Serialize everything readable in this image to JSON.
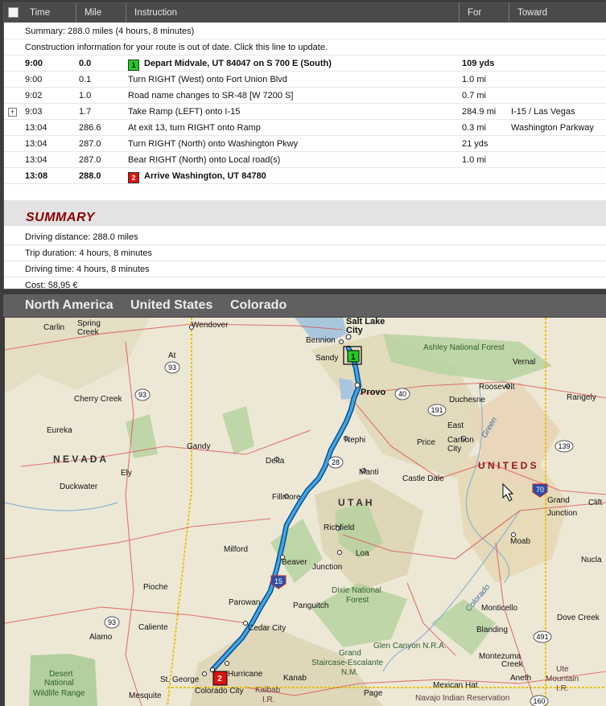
{
  "columns": {
    "time": "Time",
    "mile": "Mile",
    "instruction": "Instruction",
    "for": "For",
    "toward": "Toward"
  },
  "summary_line": "Summary:  288.0 miles (4 hours, 8 minutes)",
  "construction_line": "Construction information for your route is out of date.  Click this line to update.",
  "steps": [
    {
      "time": "9:00",
      "mile": "0.0",
      "marker": "1",
      "instruction": "Depart Midvale, UT 84047 on S 700 E (South)",
      "for": "109 yds",
      "toward": "",
      "bold": true
    },
    {
      "time": "9:00",
      "mile": "0.1",
      "marker": "",
      "instruction": "Turn RIGHT (West) onto Fort Union Blvd",
      "for": "1.0 mi",
      "toward": "",
      "bold": false
    },
    {
      "time": "9:02",
      "mile": "1.0",
      "marker": "",
      "instruction": "Road name changes to SR-48 [W 7200 S]",
      "for": "0.7 mi",
      "toward": "",
      "bold": false
    },
    {
      "time": "9:03",
      "mile": "1.7",
      "marker": "",
      "instruction": "Take Ramp (LEFT) onto I-15",
      "for": "284.9 mi",
      "toward": "I-15 / Las Vegas",
      "bold": false,
      "expandable": "+"
    },
    {
      "time": "13:04",
      "mile": "286.6",
      "marker": "",
      "instruction": "At exit 13, turn RIGHT onto Ramp",
      "for": "0.3 mi",
      "toward": "Washington Parkway",
      "bold": false
    },
    {
      "time": "13:04",
      "mile": "287.0",
      "marker": "",
      "instruction": "Turn RIGHT (North) onto Washington Pkwy",
      "for": "21 yds",
      "toward": "",
      "bold": false
    },
    {
      "time": "13:04",
      "mile": "287.0",
      "marker": "",
      "instruction": "Bear RIGHT (North) onto Local road(s)",
      "for": "1.0 mi",
      "toward": "",
      "bold": false
    },
    {
      "time": "13:08",
      "mile": "288.0",
      "marker": "2",
      "instruction": "Arrive Washington, UT 84780",
      "for": "",
      "toward": "",
      "bold": true
    }
  ],
  "summary": {
    "title": "SUMMARY",
    "driving_distance": "Driving distance:  288.0 miles",
    "trip_duration": "Trip duration:  4 hours, 8 minutes",
    "driving_time": "Driving time:  4 hours, 8 minutes",
    "cost": "Cost:  58,95 €"
  },
  "map_breadcrumb": [
    "North America",
    "United States",
    "Colorado"
  ],
  "map_labels": {
    "carlin": "Carlin",
    "spring": "Spring",
    "creek": "Creek",
    "wendover": "Wendover",
    "salt": "Salt Lake",
    "city": "City",
    "bennion": "Bennion",
    "sandy": "Sandy",
    "ashley": "Ashley National Forest",
    "vernal": "Vernal",
    "at": "At",
    "cherry": "Cherry Creek",
    "provo": "Provo",
    "duchesne": "Duchesne",
    "roosevelt": "Roosevelt",
    "rangely": "Rangely",
    "eureka": "Eureka",
    "nephi": "Nephi",
    "gandy": "Gandy",
    "price": "Price",
    "eastcarbon1": "East",
    "eastcarbon2": "Carbon",
    "eastcarbon3": "City",
    "green": "Green",
    "nevada": "N E V A D A",
    "ely": "Ely",
    "delta": "Delta",
    "united": "U N I T E D  S",
    "manti": "Manti",
    "castle": "Castle Dale",
    "duckwater": "Duckwater",
    "fillmore": "Fillmore",
    "utah": "U T A H",
    "grand1": "Grand",
    "grand2": "Junction",
    "clift": "Clift",
    "richfield": "Richfield",
    "moab": "Moab",
    "milford": "Milford",
    "loa": "Loa",
    "beaver": "Beaver",
    "junction": "Junction",
    "monticello_hidden": "",
    "nucla": "Nucla",
    "pioche": "Pioche",
    "dixie1": "Dixie National",
    "dixie2": "Forest",
    "colorado_river": "Colorado",
    "parowan": "Parowan",
    "panguitch": "Panguitch",
    "monticello": "Monticello",
    "dove": "Dove Creek",
    "cedar": "Cedar City",
    "caliente": "Caliente",
    "blanding": "Blanding",
    "alamo": "Alamo",
    "glen": "Glen Canyon N.R.A.",
    "montezuma1": "Montezuma",
    "montezuma2": "Creek",
    "gse1": "Grand",
    "gse2": "Staircase-Escalante",
    "gse3": "N.M.",
    "ute1": "Ute",
    "ute2": "Mountain",
    "ute3": "I.R.",
    "desert1": "Desert",
    "desert2": "National",
    "desert3": "Wildlife Range",
    "stgeorge": "St. George",
    "hurricane": "Hurricane",
    "kanab": "Kanab",
    "aneth": "Aneth",
    "mexican": "Mexican Hat",
    "mesquite": "Mesquite",
    "colcity": "Colorado City",
    "kaibab1": "Kaibab",
    "kaibab2": "I.R.",
    "page": "Page",
    "navajo": "Navajo Indian Reservation",
    "shield93a": "93",
    "shield93b": "93",
    "shield93c": "93",
    "shield40": "40",
    "shield191": "191",
    "shield139": "139",
    "shield28": "28",
    "shield70": "70",
    "shield15": "15",
    "shield491": "491",
    "shield160": "160",
    "m1": "1",
    "m2": "2"
  },
  "colors": {
    "route": "#1a7fd6",
    "route_outline": "#0b4f8c",
    "start": "#22cc22",
    "end": "#dd1111",
    "state_line": "#e8c200",
    "summary_title": "#8b0000"
  }
}
